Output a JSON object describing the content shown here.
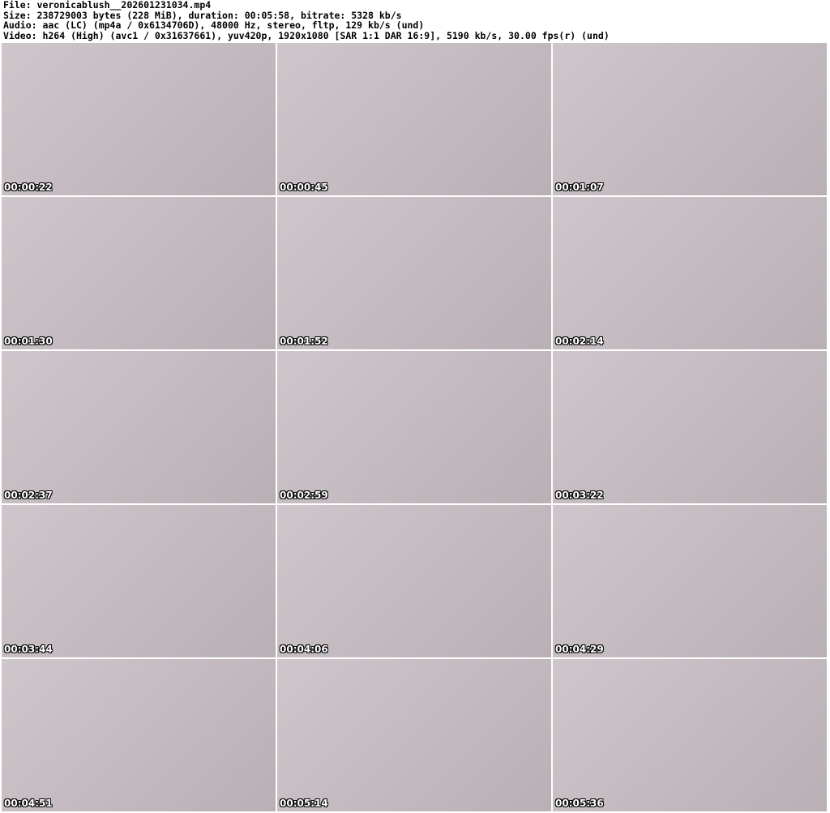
{
  "header": {
    "file": "File: veronicablush__202601231034.mp4",
    "size": "Size: 238729003 bytes (228 MiB), duration: 00:05:58, bitrate: 5328 kb/s",
    "audio": "Audio: aac (LC) (mp4a / 0x6134706D), 48000 Hz, stereo, fltp, 129 kb/s (und)",
    "video": "Video: h264 (High) (avc1 / 0x31637661), yuv420p, 1920x1080 [SAR 1:1 DAR 16:9], 5190 kb/s, 30.00 fps(r) (und)"
  },
  "thumbnails": [
    {
      "timestamp": "00:00:22"
    },
    {
      "timestamp": "00:00:45"
    },
    {
      "timestamp": "00:01:07"
    },
    {
      "timestamp": "00:01:30"
    },
    {
      "timestamp": "00:01:52"
    },
    {
      "timestamp": "00:02:14"
    },
    {
      "timestamp": "00:02:37"
    },
    {
      "timestamp": "00:02:59"
    },
    {
      "timestamp": "00:03:22"
    },
    {
      "timestamp": "00:03:44"
    },
    {
      "timestamp": "00:04:06"
    },
    {
      "timestamp": "00:04:29"
    },
    {
      "timestamp": "00:04:51"
    },
    {
      "timestamp": "00:05:14"
    },
    {
      "timestamp": "00:05:36"
    }
  ]
}
